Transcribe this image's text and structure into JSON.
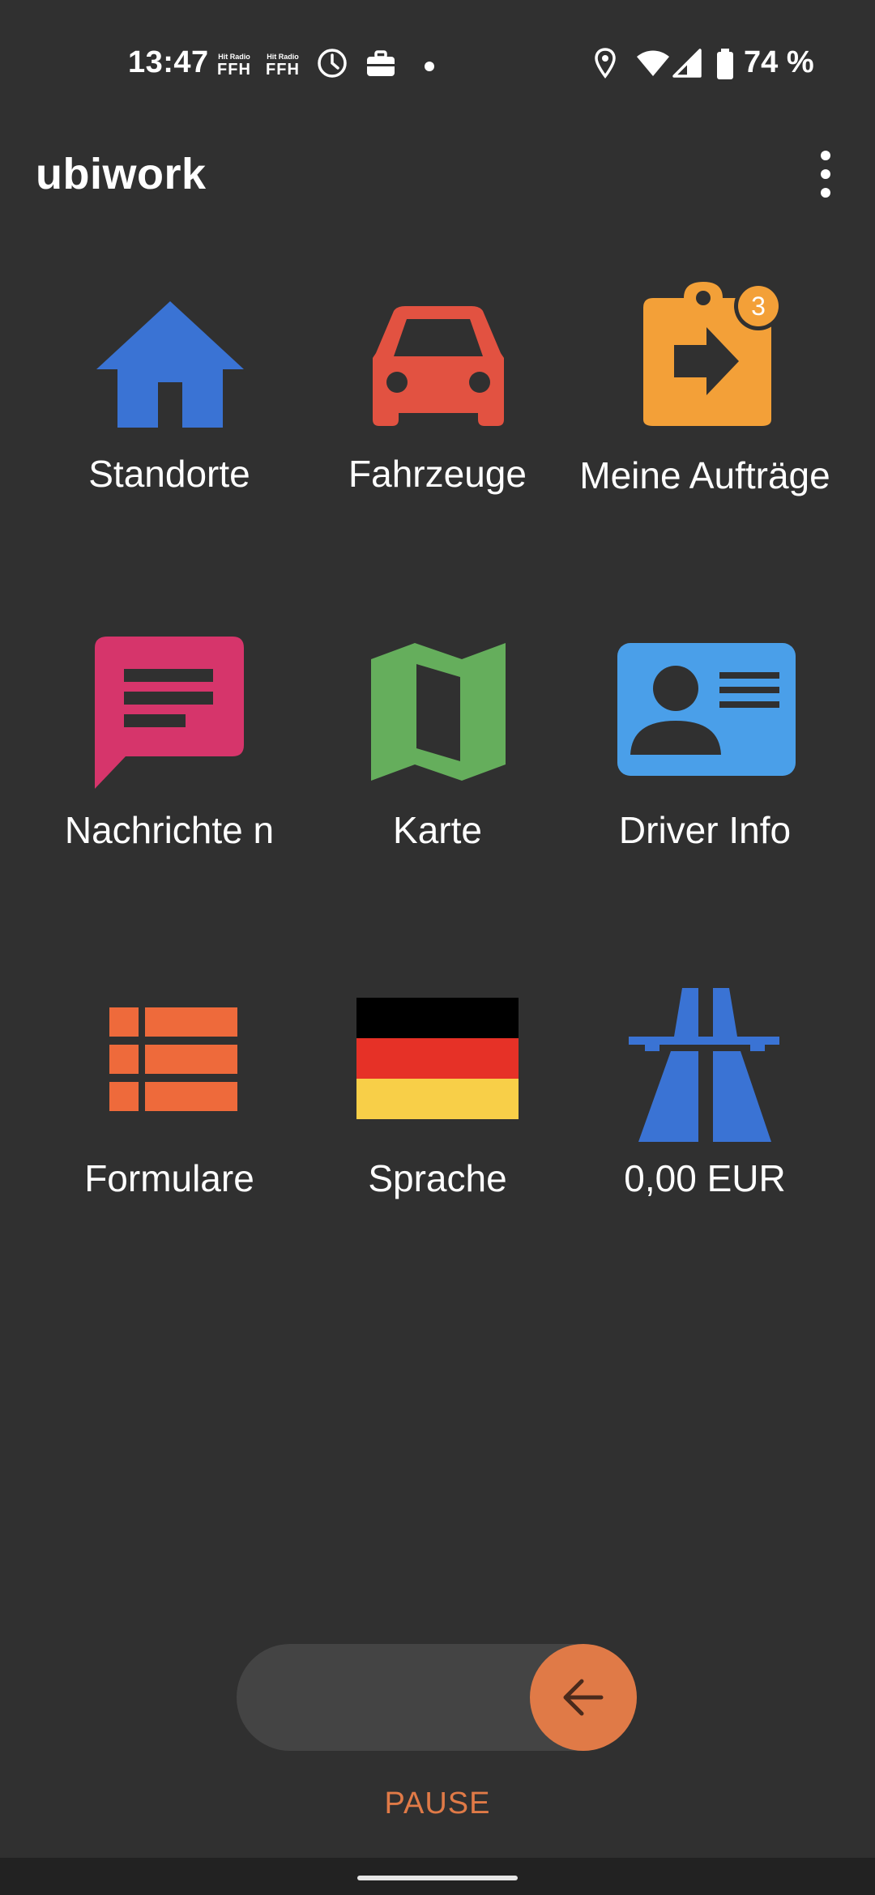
{
  "status_bar": {
    "time": "13:47",
    "radio_small": "Hit Radio",
    "radio_big": "FFH",
    "battery": "74 %"
  },
  "app_bar": {
    "title": "ubiwork"
  },
  "tiles": [
    {
      "label": "Standorte",
      "icon": "home-icon",
      "color": "#3a73d4"
    },
    {
      "label": "Fahrzeuge",
      "icon": "car-icon",
      "color": "#e25241"
    },
    {
      "label": "Meine Aufträge",
      "icon": "assignment-tag-icon",
      "color": "#f3a038",
      "badge": "3"
    },
    {
      "label": "Nachrichte n",
      "icon": "message-icon",
      "color": "#d6356b"
    },
    {
      "label": "Karte",
      "icon": "map-icon",
      "color": "#65ae5c"
    },
    {
      "label": "Driver Info",
      "icon": "driver-id-card-icon",
      "color": "#4a9fe9"
    },
    {
      "label": "Formulare",
      "icon": "list-form-icon",
      "color": "#ee6a3b"
    },
    {
      "label": "Sprache",
      "icon": "german-flag-icon",
      "colors": [
        "#000000",
        "#e63127",
        "#f8cf48"
      ]
    },
    {
      "label": "0,00 EUR",
      "icon": "highway-toll-icon",
      "color": "#3a73d4"
    }
  ],
  "bottom": {
    "pause_label": "PAUSE",
    "accent_color": "#e07a47"
  }
}
